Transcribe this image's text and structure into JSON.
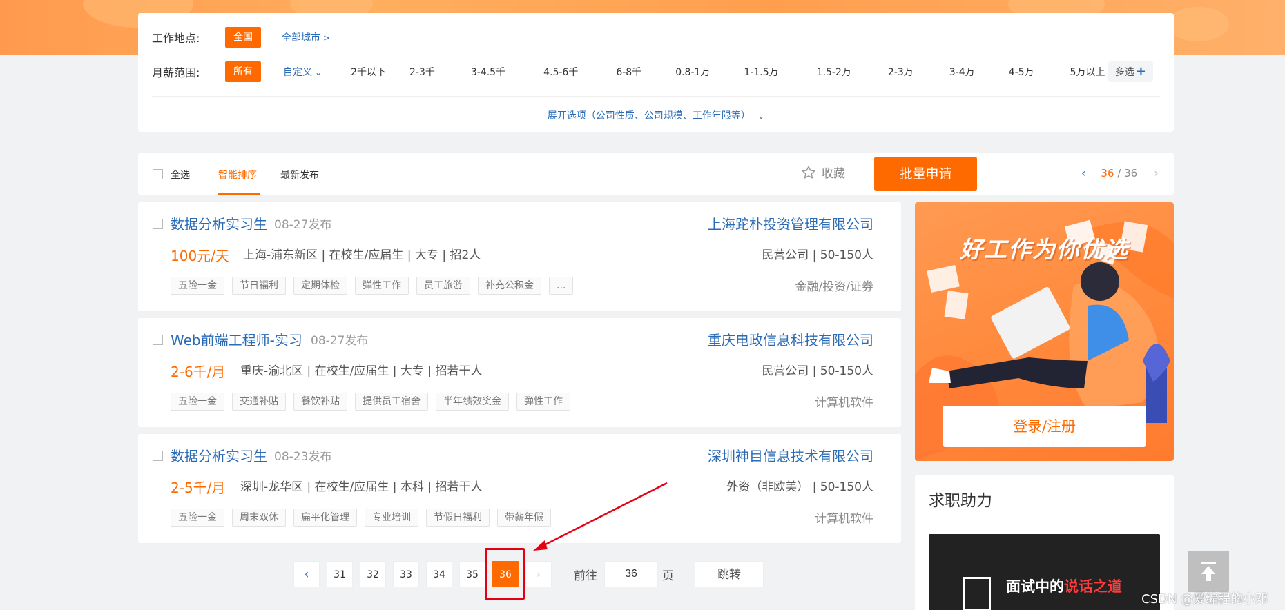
{
  "filters": {
    "location_label": "工作地点:",
    "location_active": "全国",
    "all_cities": "全部城市",
    "salary_label": "月薪范围:",
    "salary_active": "所有",
    "salary_custom": "自定义",
    "salary_options": [
      "2千以下",
      "2-3千",
      "3-4.5千",
      "4.5-6千",
      "6-8千",
      "0.8-1万",
      "1-1.5万",
      "1.5-2万",
      "2-3万",
      "3-4万",
      "4-5万",
      "5万以上"
    ],
    "multi_select": "多选",
    "expand": "展开选项（公司性质、公司规模、工作年限等）"
  },
  "sort": {
    "select_all": "全选",
    "tab_smart": "智能排序",
    "tab_latest": "最新发布",
    "favorite": "收藏",
    "batch_apply": "批量申请",
    "page_current": "36",
    "page_sep": "/",
    "page_total": "36"
  },
  "jobs": [
    {
      "title": "数据分析实习生",
      "date": "08-27发布",
      "company": "上海跎朴投资管理有限公司",
      "salary": "100元/天",
      "meta": "上海-浦东新区 | 在校生/应届生 | 大专 | 招2人",
      "company_type": "民营公司 | 50-150人",
      "tags": [
        "五险一金",
        "节日福利",
        "定期体检",
        "弹性工作",
        "员工旅游",
        "补充公积金",
        "..."
      ],
      "industry": "金融/投资/证券"
    },
    {
      "title": "Web前端工程师-实习",
      "date": "08-27发布",
      "company": "重庆电政信息科技有限公司",
      "salary": "2-6千/月",
      "meta": "重庆-渝北区 | 在校生/应届生 | 大专 | 招若干人",
      "company_type": "民营公司 | 50-150人",
      "tags": [
        "五险一金",
        "交通补贴",
        "餐饮补贴",
        "提供员工宿舍",
        "半年绩效奖金",
        "弹性工作"
      ],
      "industry": "计算机软件"
    },
    {
      "title": "数据分析实习生",
      "date": "08-23发布",
      "company": "深圳神目信息技术有限公司",
      "salary": "2-5千/月",
      "meta": "深圳-龙华区 | 在校生/应届生 | 本科 | 招若干人",
      "company_type": "外资（非欧美） | 50-150人",
      "tags": [
        "五险一金",
        "周末双休",
        "扁平化管理",
        "专业培训",
        "节假日福利",
        "带薪年假"
      ],
      "industry": "计算机软件"
    }
  ],
  "pagination": {
    "prev": "‹",
    "pages": [
      "31",
      "32",
      "33",
      "34",
      "35",
      "36"
    ],
    "next": "›",
    "goto_label": "前往",
    "goto_value": "36",
    "goto_unit": "页",
    "jump": "跳转"
  },
  "sidebar": {
    "promo_headline": "好工作为你优选",
    "login_button": "登录/注册",
    "helper_title": "求职助力",
    "helper_card_text_a": "面试中的",
    "helper_card_text_b": "说话之道"
  },
  "watermark": "CSDN @爱编程的小邓",
  "colors": {
    "accent": "#ff6a00",
    "link": "#2a6bb5",
    "annotation": "#e60012"
  }
}
